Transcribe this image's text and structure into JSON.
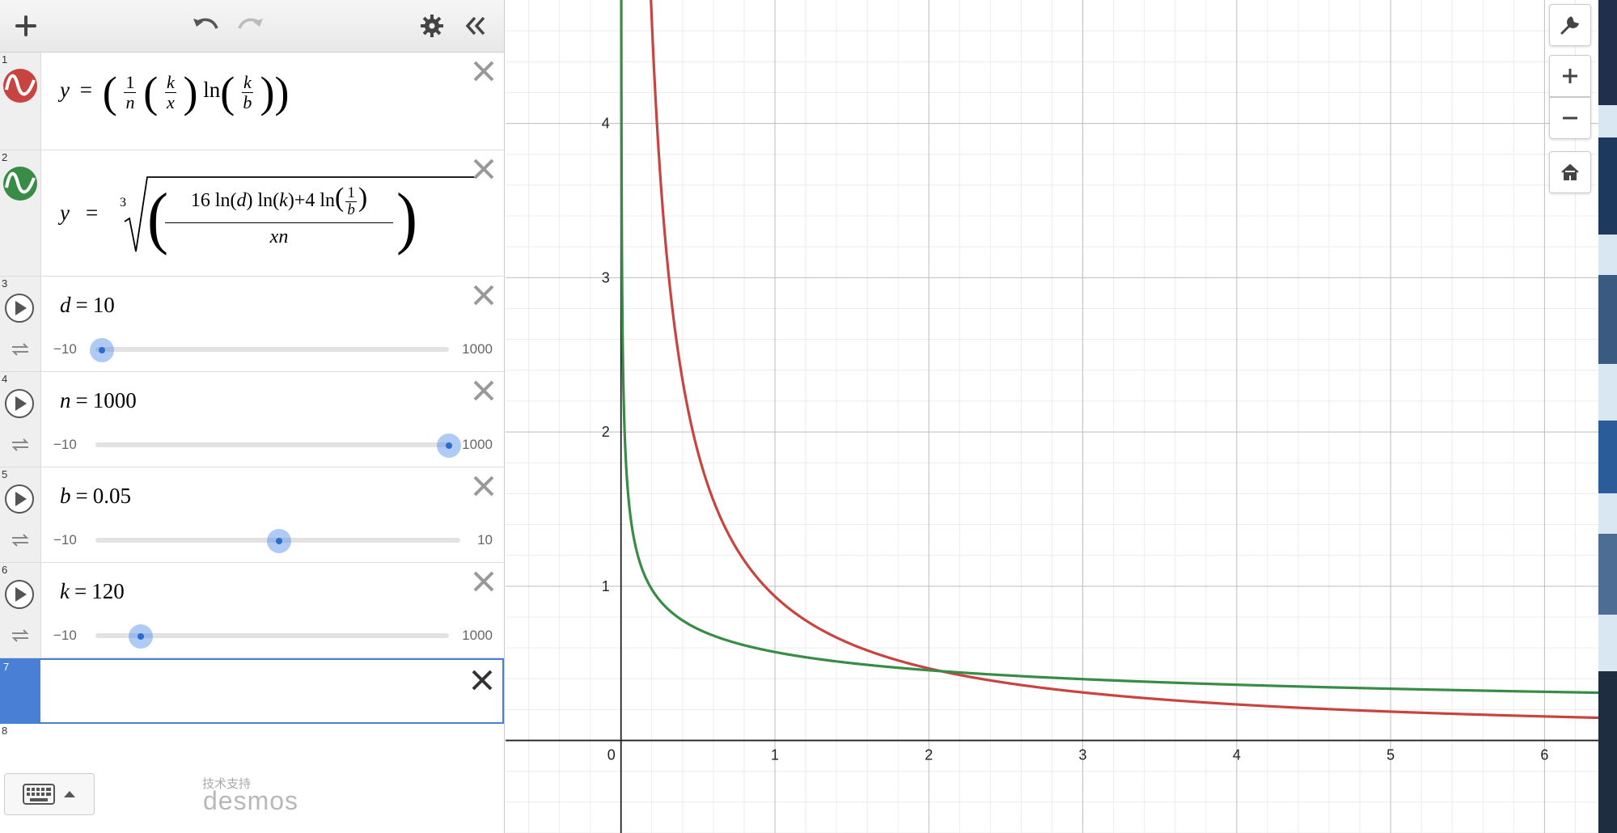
{
  "app": {
    "brand": "desmos",
    "powered_by": "技术支持"
  },
  "toolbar": {
    "add_icon": "plus-icon",
    "undo_icon": "undo-icon",
    "redo_icon": "redo-icon",
    "settings_icon": "gear-icon",
    "collapse_icon": "double-chevron-left-icon"
  },
  "expressions": [
    {
      "index": "1",
      "color": "#c74440",
      "latex": "y=\\left(\\frac{1}{n}\\left(\\frac{k}{x}\\right)\\ln\\left(\\frac{k}{b}\\right)\\right)",
      "display": {
        "y": "y",
        "eq": "=",
        "f1n": "1",
        "f1d": "n",
        "f2n": "k",
        "f2d": "x",
        "ln": "ln",
        "f3n": "k",
        "f3d": "b"
      }
    },
    {
      "index": "2",
      "color": "#388c46",
      "latex": "y=\\sqrt[3]{\\left(\\frac{16\\ln(d)\\ln(k)+4\\ln\\left(\\frac{1}{b}\\right)}{xn}\\right)}",
      "display": {
        "y": "y",
        "eq": "=",
        "root": "3",
        "num_a": "16",
        "ln": "ln",
        "d": "d",
        "k": "k",
        "plus": "+4",
        "fn": "1",
        "fd": "b",
        "den": "xn"
      }
    },
    {
      "index": "3",
      "name": "d",
      "value": "10",
      "min": "−10",
      "max": "1000",
      "level": 0.019
    },
    {
      "index": "4",
      "name": "n",
      "value": "1000",
      "min": "−10",
      "max": "1000",
      "level": 1.0
    },
    {
      "index": "5",
      "name": "b",
      "value": "0.05",
      "min": "−10",
      "max": "10",
      "level": 0.5025
    },
    {
      "index": "6",
      "name": "k",
      "value": "120",
      "min": "−10",
      "max": "1000",
      "level": 0.1287
    },
    {
      "index": "7",
      "empty": true
    },
    {
      "index": "8",
      "empty": true
    }
  ],
  "keyboard": {
    "icon": "keyboard-icon",
    "toggle_icon": "caret-up-icon"
  },
  "graph_controls": {
    "settings_icon": "wrench-icon",
    "zoom_in_icon": "plus-icon",
    "zoom_out_icon": "minus-icon",
    "home_icon": "home-icon"
  },
  "chart_data": {
    "type": "line",
    "xlim": [
      -0.75,
      6.35
    ],
    "ylim": [
      -0.6,
      4.8
    ],
    "x_ticks": [
      "0",
      "1",
      "2",
      "3",
      "4",
      "5",
      "6"
    ],
    "y_ticks": [
      "1",
      "2",
      "3",
      "4"
    ],
    "grid": true,
    "series": [
      {
        "expression": "1",
        "color": "#c74440",
        "formula": "(1/n)(k/x)ln(k/b)",
        "params": {
          "n": 1000,
          "k": 120,
          "b": 0.05
        }
      },
      {
        "expression": "2",
        "color": "#388c46",
        "formula": "cbrt((16 ln(d) ln(k) + 4 ln(1/b))/(x n))",
        "params": {
          "n": 1000,
          "k": 120,
          "b": 0.05,
          "d": 10
        }
      }
    ]
  }
}
